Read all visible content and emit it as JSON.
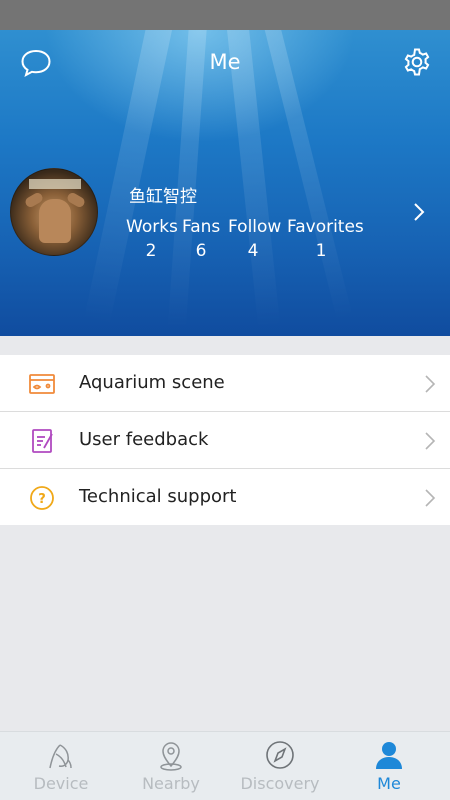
{
  "header": {
    "title": "Me",
    "message_icon": "chat-bubble-icon",
    "settings_icon": "gear-icon"
  },
  "profile": {
    "username": "鱼缸智控",
    "stats": [
      {
        "label": "Works",
        "value": "2"
      },
      {
        "label": "Fans",
        "value": "6"
      },
      {
        "label": "Follow",
        "value": "4"
      },
      {
        "label": "Favorites",
        "value": "1"
      }
    ]
  },
  "menu": {
    "items": [
      {
        "label": "Aquarium scene",
        "icon": "aquarium-icon",
        "color": "#f08a3a"
      },
      {
        "label": "User feedback",
        "icon": "feedback-icon",
        "color": "#b04ac0"
      },
      {
        "label": "Technical support",
        "icon": "help-icon",
        "color": "#f0a818"
      }
    ]
  },
  "tabbar": {
    "tabs": [
      {
        "label": "Device",
        "icon": "leaf-icon"
      },
      {
        "label": "Nearby",
        "icon": "location-pin-icon"
      },
      {
        "label": "Discovery",
        "icon": "compass-icon"
      },
      {
        "label": "Me",
        "icon": "person-icon",
        "active": true
      }
    ],
    "active_color": "#1e88d8",
    "inactive_color": "#b7bcc0"
  }
}
